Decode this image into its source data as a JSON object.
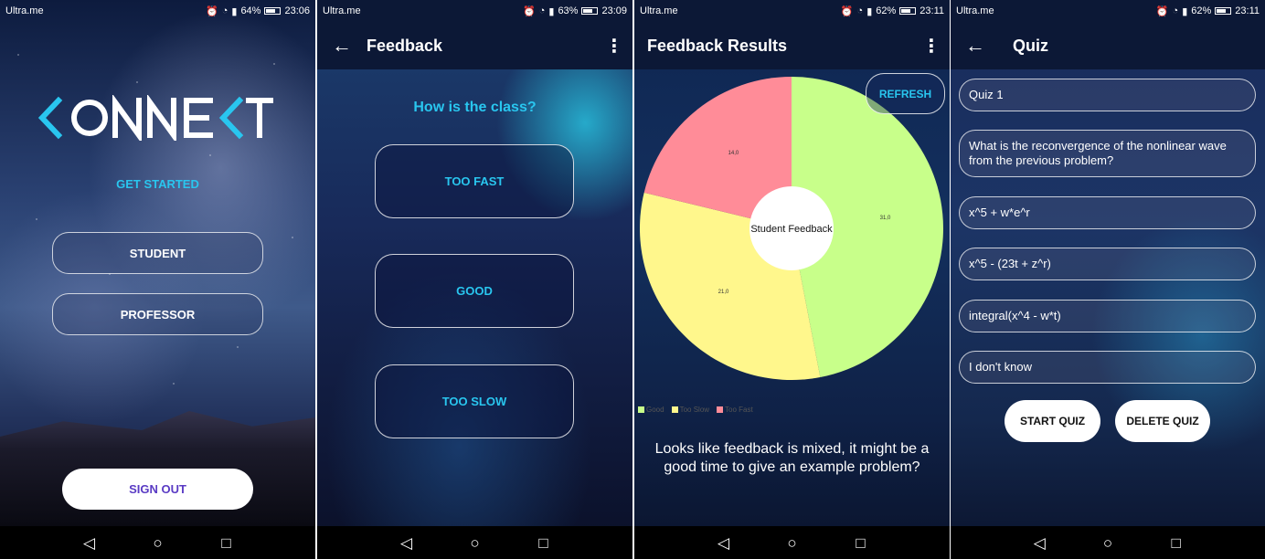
{
  "screens": [
    {
      "status": {
        "carrier": "Ultra.me",
        "battery": "64%",
        "time": "23:06"
      },
      "logo": "KONNEKT",
      "get_started": "GET STARTED",
      "buttons": {
        "student": "STUDENT",
        "professor": "PROFESSOR",
        "sign_out": "SIGN OUT"
      }
    },
    {
      "status": {
        "carrier": "Ultra.me",
        "battery": "63%",
        "time": "23:09"
      },
      "title": "Feedback",
      "question": "How is the class?",
      "options": [
        "TOO FAST",
        "GOOD",
        "TOO SLOW"
      ]
    },
    {
      "status": {
        "carrier": "Ultra.me",
        "battery": "62%",
        "time": "23:11"
      },
      "title": "Feedback Results",
      "refresh_label": "REFRESH",
      "message": "Looks like feedback is mixed, it might be a good time to give an example problem?",
      "chart_data": {
        "type": "pie",
        "center_label": "Student Feedback",
        "slices": [
          {
            "label": "Good",
            "value": 31.0,
            "value_label": "31,0",
            "color": "#c8ff8a"
          },
          {
            "label": "Too Slow",
            "value": 21.0,
            "value_label": "21,0",
            "color": "#fff78c"
          },
          {
            "label": "Too Fast",
            "value": 14.0,
            "value_label": "14,0",
            "color": "#ff8c98"
          }
        ],
        "legend": [
          "Good",
          "Too Slow",
          "Too Fast"
        ],
        "legend_position": "bottom-left"
      }
    },
    {
      "status": {
        "carrier": "Ultra.me",
        "battery": "62%",
        "time": "23:11"
      },
      "title": "Quiz",
      "fields": [
        "Quiz 1",
        "What is the reconvergence of the nonlinear wave from the previous problem?",
        "x^5 + w*e^r",
        "x^5 - (23t + z^r)",
        "integral(x^4 - w*t)",
        "I don't know"
      ],
      "buttons": {
        "start": "START QUIZ",
        "delete": "DELETE QUIZ"
      }
    }
  ],
  "colors": {
    "accent": "#29c6ef",
    "sign_out_text": "#5a3bc4",
    "appbar": "#0c1836"
  },
  "nav": {
    "back": "◁",
    "home": "○",
    "recents": "□"
  }
}
